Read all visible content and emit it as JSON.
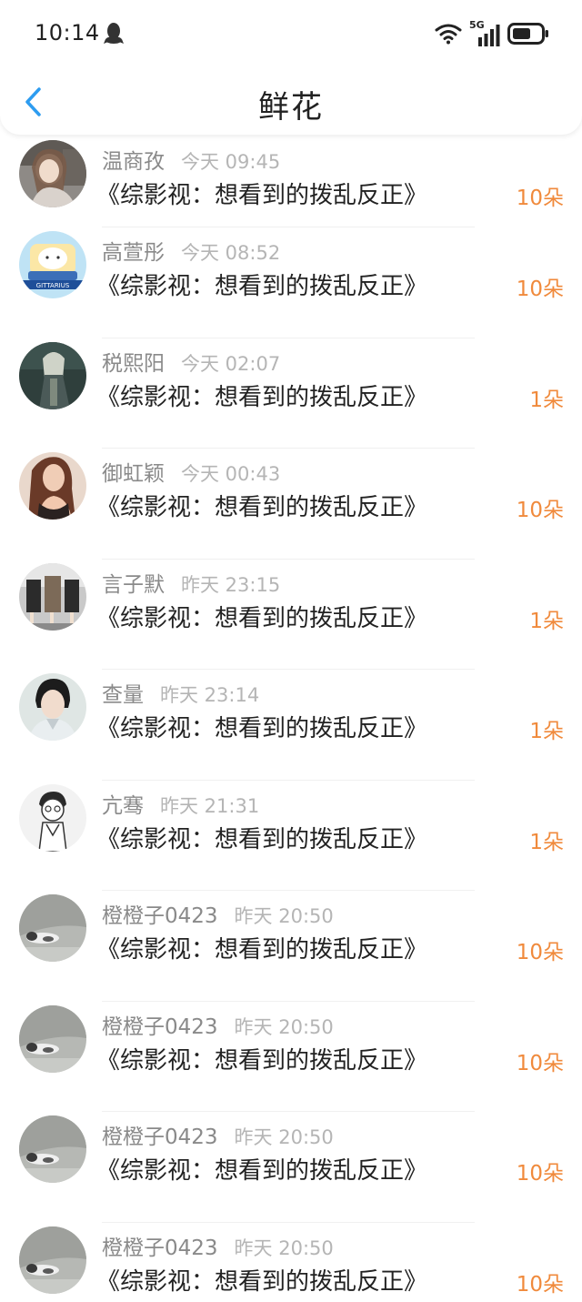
{
  "status_bar": {
    "time": "10:14",
    "network": "5G"
  },
  "header": {
    "title": "鲜花"
  },
  "colors": {
    "accent_blue": "#2d9cf0",
    "count_orange": "#f08a3c"
  },
  "list": [
    {
      "name": "温商孜",
      "time": "今天 09:45",
      "title": "《综影视：想看到的拨乱反正》",
      "count": "10朵",
      "avatar": "avatar-girl-photo"
    },
    {
      "name": "高萱彤",
      "time": "今天 08:52",
      "title": "《综影视：想看到的拨乱反正》",
      "count": "10朵",
      "avatar": "avatar-sagittarius-cartoon"
    },
    {
      "name": "税熙阳",
      "time": "今天 02:07",
      "title": "《综影视：想看到的拨乱反正》",
      "count": "1朵",
      "avatar": "avatar-anime-dark"
    },
    {
      "name": "御虹颖",
      "time": "今天 00:43",
      "title": "《综影视：想看到的拨乱反正》",
      "count": "10朵",
      "avatar": "avatar-woman-photo"
    },
    {
      "name": "言子默",
      "time": "昨天 23:15",
      "title": "《综影视：想看到的拨乱反正》",
      "count": "1朵",
      "avatar": "avatar-students-photo"
    },
    {
      "name": "查量",
      "time": "昨天 23:14",
      "title": "《综影视：想看到的拨乱反正》",
      "count": "1朵",
      "avatar": "avatar-man-costume"
    },
    {
      "name": "亢骞",
      "time": "昨天 21:31",
      "title": "《综影视：想看到的拨乱反正》",
      "count": "1朵",
      "avatar": "avatar-sketch-figure"
    },
    {
      "name": "橙橙子0423",
      "time": "昨天 20:50",
      "title": "《综影视：想看到的拨乱反正》",
      "count": "10朵",
      "avatar": "avatar-cat-photo"
    },
    {
      "name": "橙橙子0423",
      "time": "昨天 20:50",
      "title": "《综影视：想看到的拨乱反正》",
      "count": "10朵",
      "avatar": "avatar-cat-photo"
    },
    {
      "name": "橙橙子0423",
      "time": "昨天 20:50",
      "title": "《综影视：想看到的拨乱反正》",
      "count": "10朵",
      "avatar": "avatar-cat-photo"
    },
    {
      "name": "橙橙子0423",
      "time": "昨天 20:50",
      "title": "《综影视：想看到的拨乱反正》",
      "count": "10朵",
      "avatar": "avatar-cat-photo"
    }
  ]
}
